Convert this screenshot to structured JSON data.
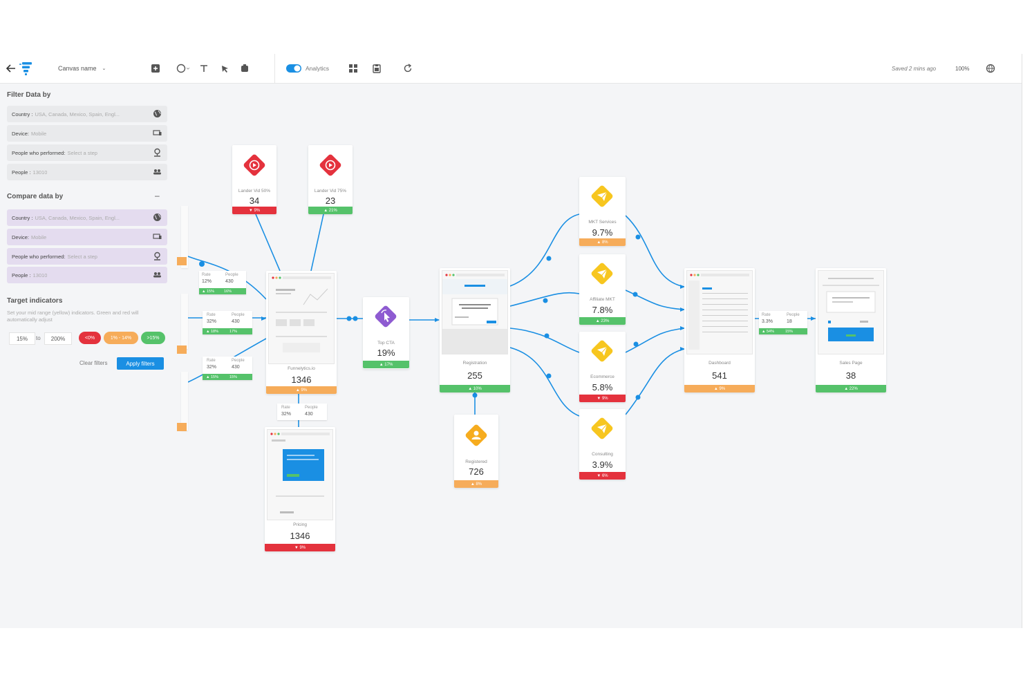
{
  "toolbar": {
    "canvas_name": "Canvas name",
    "analytics_label": "Analytics",
    "saved_text": "Saved 2 mins ago",
    "zoom": "100%"
  },
  "filter": {
    "title": "Filter Data by",
    "rows": [
      {
        "label": "Country :",
        "value": "USA, Canada, Mexico, Spain, Engl...",
        "icon": "globe-icon"
      },
      {
        "label": "Device:",
        "value": "Mobile",
        "icon": "devices-icon"
      },
      {
        "label": "People who performed:",
        "value": "Select a step",
        "icon": "location-pin-icon"
      },
      {
        "label": "People :",
        "value": "13010",
        "icon": "people-icon"
      }
    ]
  },
  "compare": {
    "title": "Compare data by",
    "collapse_symbol": "–",
    "rows": [
      {
        "label": "Country :",
        "value": "USA, Canada, Mexico, Spain, Engl...",
        "icon": "globe-icon"
      },
      {
        "label": "Device:",
        "value": "Mobile",
        "icon": "devices-icon"
      },
      {
        "label": "People who performed:",
        "value": "Select a step",
        "icon": "location-pin-icon"
      },
      {
        "label": "People :",
        "value": "13010",
        "icon": "people-icon"
      }
    ]
  },
  "target": {
    "title": "Target indicators",
    "description": "Set your mid range (yellow) indicators. Green and red will automatically adjust",
    "from_value": "15%",
    "to_word": "to",
    "to_value": "200%",
    "pill_red": "<0%",
    "pill_orange": "1% - 14%",
    "pill_green": ">15%",
    "clear_label": "Clear filters",
    "apply_label": "Apply filters"
  },
  "colors": {
    "accent": "#1a8fe3",
    "green": "#55c26a",
    "red": "#e4323d",
    "orange": "#f6ac5a",
    "purple": "#8e5bd1",
    "yellow": "#f7c61f"
  },
  "nodes": {
    "lander50": {
      "name": "Lander Vid 50%",
      "value": "34",
      "delta": "▼ 9%"
    },
    "lander75": {
      "name": "Lander Vid 75%",
      "value": "23",
      "delta": "▲ 21%"
    },
    "funnelytics": {
      "name": "Funnelytics.io",
      "value": "1346",
      "delta": "▲ 9%"
    },
    "top_cta": {
      "name": "Top CTA",
      "value": "19%",
      "delta": "▲ 17%"
    },
    "registration": {
      "name": "Registration",
      "value": "255",
      "delta": "▲ 10%"
    },
    "registered": {
      "name": "Registered",
      "value": "726",
      "delta": "▲ 8%"
    },
    "mkt_services": {
      "name": "MKT Services",
      "value": "9.7%",
      "delta": "▲ 8%"
    },
    "affiliate": {
      "name": "Affiliate MKT",
      "value": "7.8%",
      "delta": "▲ 23%"
    },
    "ecommerce": {
      "name": "Ecommerce",
      "value": "5.8%",
      "delta": "▼ 9%"
    },
    "consulting": {
      "name": "Consulting",
      "value": "3.9%",
      "delta": "▼ 6%"
    },
    "dashboard": {
      "name": "Dashboard",
      "value": "541",
      "delta": "▲ 9%"
    },
    "sales": {
      "name": "Sales Page",
      "value": "38",
      "delta": "▲ 22%"
    },
    "pricing": {
      "name": "Pricing",
      "value": "1346",
      "delta": "▼ 9%"
    }
  },
  "stats": {
    "s1": {
      "rate_label": "Rate",
      "rate": "12%",
      "people_label": "People",
      "people": "430",
      "d1": "▲ 15%",
      "d2": "16%"
    },
    "s2": {
      "rate_label": "Rate",
      "rate": "32%",
      "people_label": "People",
      "people": "430",
      "d1": "▲ 18%",
      "d2": "17%"
    },
    "s3": {
      "rate_label": "Rate",
      "rate": "32%",
      "people_label": "People",
      "people": "430",
      "d1": "▲ 15%",
      "d2": "15%"
    },
    "s4": {
      "rate_label": "Rate",
      "rate": "32%",
      "people_label": "People",
      "people": "430"
    },
    "s5": {
      "rate_label": "Rate",
      "rate": "3.3%",
      "people_label": "People",
      "people": "18",
      "d1": "▲ 54%",
      "d2": "15%"
    }
  }
}
